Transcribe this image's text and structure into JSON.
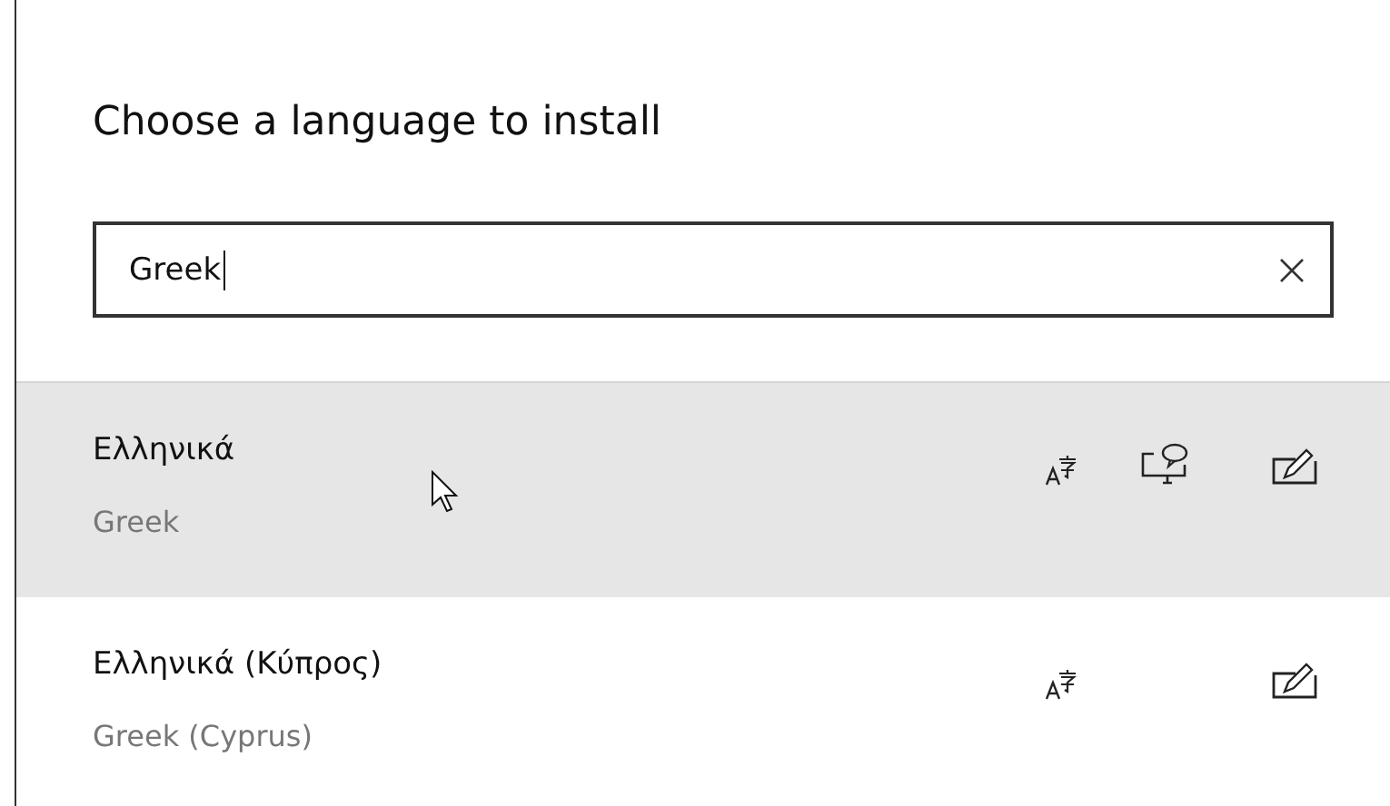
{
  "dialog": {
    "title": "Choose a language to install"
  },
  "search": {
    "value": "Greek"
  },
  "languages": [
    {
      "name": "Ελληνικά",
      "english_name": "Greek",
      "selected": true,
      "features": [
        {
          "kind": "text"
        },
        {
          "kind": "speech"
        },
        {
          "kind": "handwriting"
        }
      ]
    },
    {
      "name": "Ελληνικά (Κύπρος)",
      "english_name": "Greek (Cyprus)",
      "selected": false,
      "features": [
        {
          "kind": "text"
        },
        {
          "kind": "handwriting"
        }
      ]
    }
  ]
}
